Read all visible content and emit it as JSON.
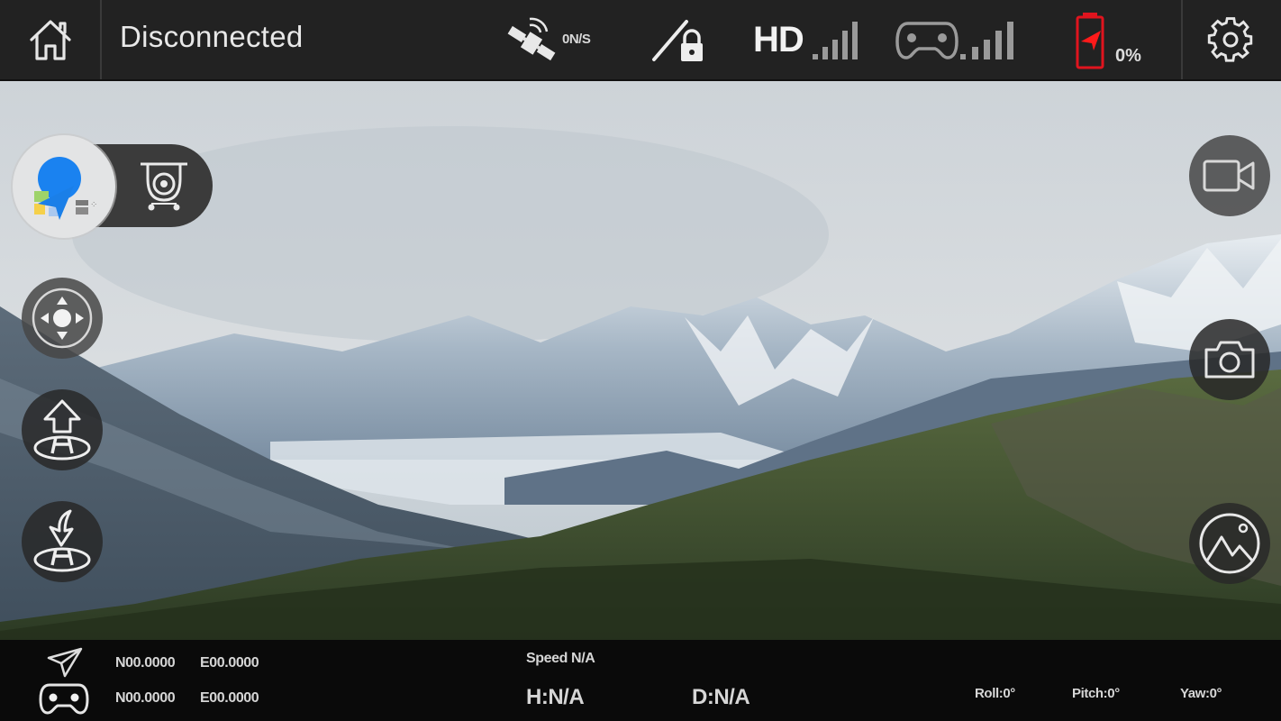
{
  "topbar": {
    "home_icon": "home-icon",
    "connection_status": "Disconnected",
    "gps": {
      "icon": "satellite-icon",
      "value": "0N/S"
    },
    "propeller_lock_icon": "propeller-lock-icon",
    "video_link": {
      "label": "HD",
      "signal_bars": 5,
      "active_bars": 0
    },
    "remote_controller": {
      "icon": "gamepad-icon",
      "signal_bars": 5,
      "active_bars": 0
    },
    "battery": {
      "icon": "battery-icon",
      "value": "0%",
      "percent": 0,
      "color": "#e0141e"
    },
    "settings_icon": "gear-icon"
  },
  "left_controls": {
    "map_button": "map-app-icon",
    "gimbal_button": "gimbal-icon",
    "joystick_button": "joystick-icon",
    "takeoff_button": "takeoff-icon",
    "land_button": "landing-icon"
  },
  "right_controls": {
    "record_button": "video-camera-icon",
    "photo_button": "camera-icon",
    "gallery_button": "gallery-icon"
  },
  "bottombar": {
    "aircraft_position": {
      "icon": "paper-plane-icon",
      "lat": "N00.0000",
      "lon": "E00.0000"
    },
    "controller_position": {
      "icon": "gamepad-icon",
      "lat": "N00.0000",
      "lon": "E00.0000"
    },
    "speed": "Speed N/A",
    "height": "H:N/A",
    "distance": "D:N/A",
    "roll": "Roll:0°",
    "pitch": "Pitch:0°",
    "yaw": "Yaw:0°"
  }
}
